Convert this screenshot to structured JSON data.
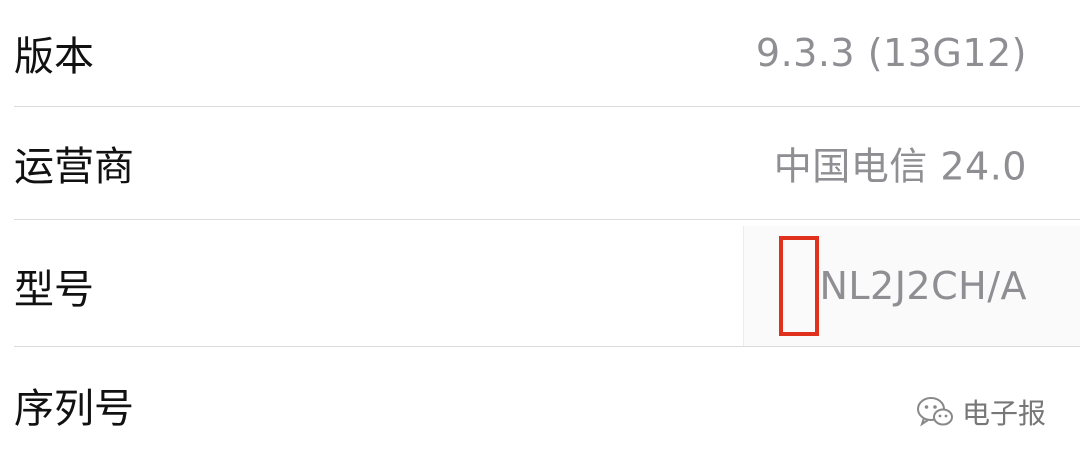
{
  "rows": [
    {
      "label": "版本",
      "value": "9.3.3 (13G12)"
    },
    {
      "label": "运营商",
      "value": "中国电信 24.0"
    },
    {
      "label": "型号",
      "value": "NL2J2CH/A"
    },
    {
      "label": "序列号",
      "value": ""
    }
  ],
  "watermark": {
    "text": "电子报",
    "icon": "wechat-icon"
  },
  "colors": {
    "label": "#111111",
    "value": "#8e8e93",
    "separator": "#dcdcdc",
    "highlight": "#e0301e"
  }
}
